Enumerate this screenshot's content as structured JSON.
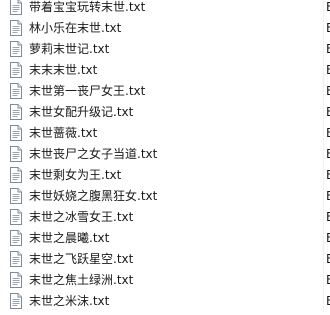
{
  "files": [
    {
      "name": "带着宝宝玩转末世.txt",
      "type": "E"
    },
    {
      "name": "林小乐在末世.txt",
      "type": "E"
    },
    {
      "name": "萝莉末世记.txt",
      "type": "E"
    },
    {
      "name": "末末末世.txt",
      "type": "E"
    },
    {
      "name": "末世第一丧尸女王.txt",
      "type": "E"
    },
    {
      "name": "末世女配升级记.txt",
      "type": "E"
    },
    {
      "name": "末世蔷薇.txt",
      "type": "E"
    },
    {
      "name": "末世丧尸之女子当道.txt",
      "type": "E"
    },
    {
      "name": "末世剩女为王.txt",
      "type": "E"
    },
    {
      "name": "末世妖娆之腹黑狂女.txt",
      "type": "E"
    },
    {
      "name": "末世之冰雪女王.txt",
      "type": "E"
    },
    {
      "name": "末世之晨曦.txt",
      "type": "E"
    },
    {
      "name": "末世之飞跃星空.txt",
      "type": "E"
    },
    {
      "name": "末世之焦土绿洲.txt",
      "type": "E"
    },
    {
      "name": "末世之米沫.txt",
      "type": "E"
    }
  ],
  "icons": {
    "file": "text-file-icon"
  },
  "colors": {
    "background": "#ffffff",
    "text": "#1a1a1a",
    "icon_border": "#7f8a99",
    "icon_fill": "#ffffff",
    "icon_lines": "#9aa5b4"
  }
}
